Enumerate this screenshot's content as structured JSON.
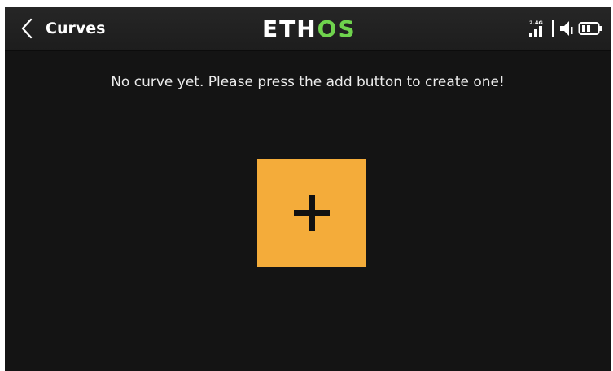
{
  "header": {
    "back_icon": "chevron-left-icon",
    "title": "Curves",
    "logo": {
      "part1": "ETH",
      "part2": "OS",
      "accent": "#6fd34d"
    },
    "status": {
      "band_label": "2.4G",
      "signal_icon": "signal-bars-icon",
      "volume_icon": "speaker-icon",
      "battery_icon": "battery-icon"
    }
  },
  "main": {
    "message": "No curve yet. Please press the add button to create one!",
    "add_button": {
      "icon": "plus-icon",
      "color": "#f4ac3a"
    }
  }
}
